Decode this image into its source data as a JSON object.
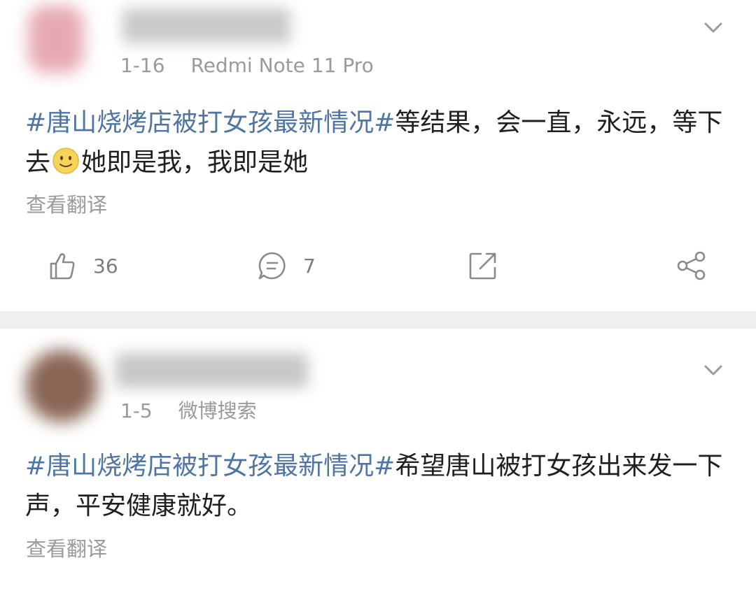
{
  "posts": [
    {
      "date": "1-16",
      "source": "Redmi Note 11 Pro",
      "hashtag": "#唐山烧烤店被打女孩最新情况#",
      "text_part1": "等结果，会一直，永远，等下去",
      "emoji": "smile-emoji",
      "text_part2": "她即是我，我即是她",
      "translate_label": "查看翻译",
      "likes": "36",
      "comments": "7"
    },
    {
      "date": "1-5",
      "source": "微博搜索",
      "hashtag": "#唐山烧烤店被打女孩最新情况#",
      "text": "希望唐山被打女孩出来发一下声，平安健康就好。",
      "translate_label": "查看翻译"
    }
  ],
  "colors": {
    "hashtag": "#4f75a5",
    "meta": "#9a9a9a",
    "separator": "#efefef"
  }
}
